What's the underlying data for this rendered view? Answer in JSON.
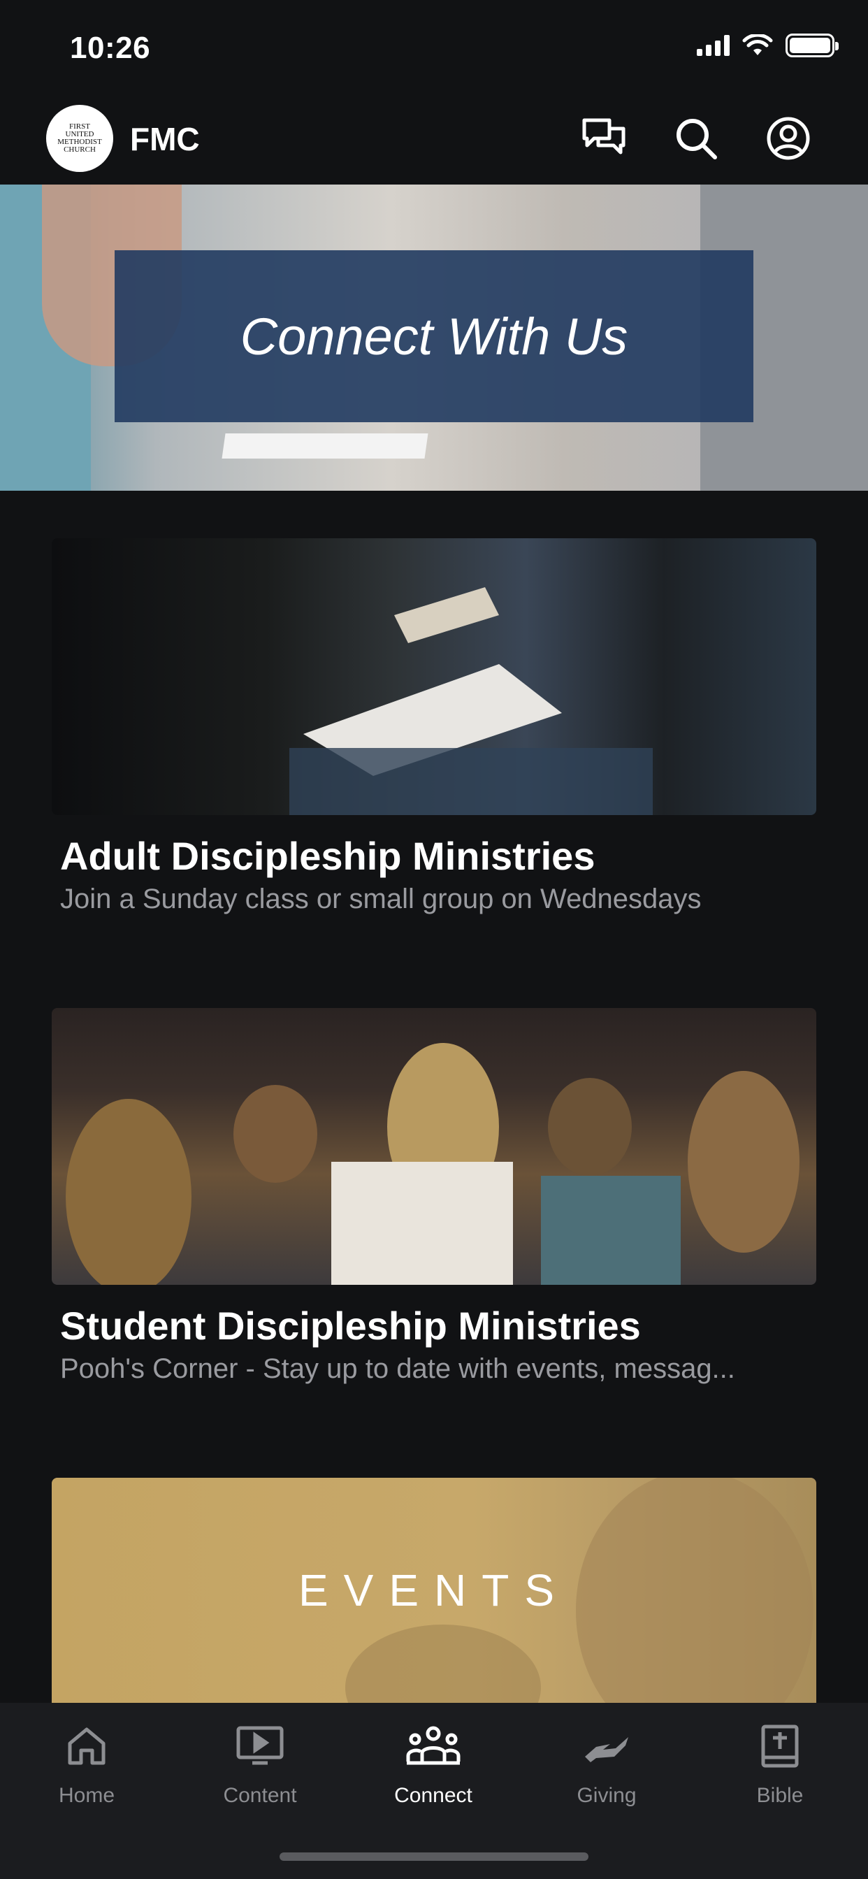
{
  "status_bar": {
    "time": "10:26",
    "icons": [
      "cellular-signal-icon",
      "wifi-icon",
      "battery-icon"
    ]
  },
  "header": {
    "logo_text": "FIRST UNITED METHODIST CHURCH",
    "title": "FMC",
    "icons": [
      "chat-icon",
      "search-icon",
      "profile-icon"
    ]
  },
  "hero": {
    "title": "Connect With Us"
  },
  "cards": [
    {
      "title": "Adult Discipleship Ministries",
      "subtitle": "Join a Sunday class or small group on Wednesdays"
    },
    {
      "title": "Student Discipleship Ministries",
      "subtitle": "Pooh's Corner - Stay up to date with events, messag..."
    },
    {
      "title": "EVENTS"
    }
  ],
  "tab_bar": {
    "items": [
      {
        "label": "Home",
        "icon": "home-icon",
        "active": false
      },
      {
        "label": "Content",
        "icon": "play-screen-icon",
        "active": false
      },
      {
        "label": "Connect",
        "icon": "group-icon",
        "active": true
      },
      {
        "label": "Giving",
        "icon": "giving-hand-icon",
        "active": false
      },
      {
        "label": "Bible",
        "icon": "bible-icon",
        "active": false
      }
    ]
  },
  "colors": {
    "background": "#111214",
    "tab_bar": "#1b1c1f",
    "hero_banner": "#213b60",
    "events_gold": "#c4a463"
  }
}
